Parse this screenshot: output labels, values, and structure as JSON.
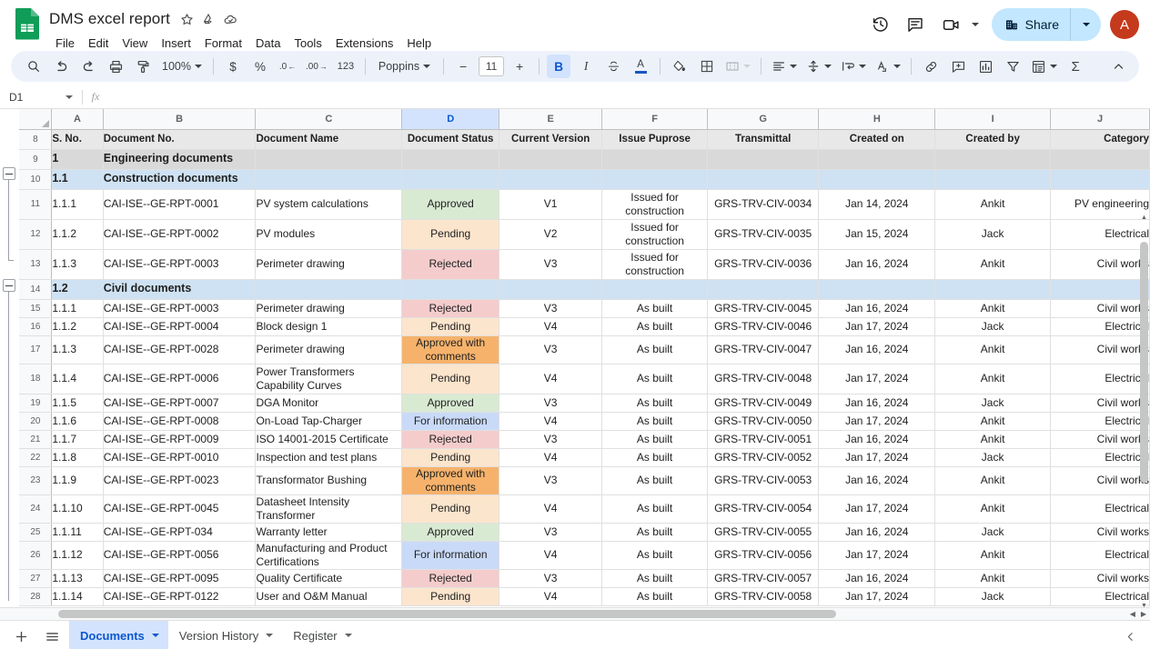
{
  "app": {
    "title": "DMS excel report",
    "logo_icon": "google-sheets-logo",
    "menu": [
      "File",
      "Edit",
      "View",
      "Insert",
      "Format",
      "Data",
      "Tools",
      "Extensions",
      "Help"
    ],
    "title_icons": [
      "star-icon",
      "move-to-drive-icon",
      "cloud-saved-icon"
    ]
  },
  "topright": {
    "history_icon": "version-history-icon",
    "comment_icon": "comment-icon",
    "meet_icon": "video-camera-icon",
    "share_label": "Share",
    "share_icon": "share-building-icon",
    "avatar_initial": "A"
  },
  "toolbar": {
    "zoom": "100%",
    "font": "Poppins",
    "font_size": "11",
    "number_format_123": "123",
    "currency": "$",
    "percent": "%",
    "decimal_decrease": ".0",
    "decimal_increase": ".00",
    "bold": "B",
    "italic": "I",
    "strikethrough": "S",
    "text_color": "A",
    "minus": "−",
    "plus": "+",
    "sum": "Σ",
    "icons": [
      "search-icon",
      "undo-icon",
      "redo-icon",
      "print-icon",
      "paint-format-icon",
      "fill-color-icon",
      "borders-icon",
      "merge-cells-icon",
      "horizontal-align-icon",
      "vertical-align-icon",
      "text-wrap-icon",
      "text-rotation-icon",
      "insert-link-icon",
      "insert-comment-icon",
      "insert-chart-icon",
      "create-filter-icon",
      "functions-icon",
      "collapse-toolbar-icon"
    ]
  },
  "formula_bar": {
    "name_box": "D1",
    "fx_label": "fx",
    "formula_value": ""
  },
  "grid": {
    "columns": [
      "A",
      "B",
      "C",
      "D",
      "E",
      "F",
      "G",
      "H",
      "I",
      "J"
    ],
    "selected_column": "D",
    "header_row_number": "8",
    "headers": [
      "S. No.",
      "Document No.",
      "Document Name",
      "Document Status",
      "Current Version",
      "Issue Puprose",
      "Transmittal",
      "Created on",
      "Created by",
      "Category"
    ],
    "status_colors": {
      "Approved": "#d9ead3",
      "Pending": "#fce5cd",
      "Rejected": "#f4cccc",
      "Approved with comments": "#f6b26b",
      "For information": "#c9daf8"
    },
    "rows": [
      {
        "n": "9",
        "type": "group1",
        "cells": [
          "1",
          "Engineering documents",
          "",
          "",
          "",
          "",
          "",
          "",
          "",
          ""
        ]
      },
      {
        "n": "10",
        "type": "group2",
        "cells": [
          "1.1",
          "Construction documents",
          "",
          "",
          "",
          "",
          "",
          "",
          "",
          ""
        ]
      },
      {
        "n": "11",
        "type": "data",
        "cells": [
          "1.1.1",
          "CAI-ISE--GE-RPT-0001",
          "PV system calculations",
          "Approved",
          "V1",
          "Issued for construction",
          "GRS-TRV-CIV-0034",
          "Jan 14, 2024",
          "Ankit",
          "PV engineering"
        ]
      },
      {
        "n": "12",
        "type": "data",
        "cells": [
          "1.1.2",
          "CAI-ISE--GE-RPT-0002",
          "PV modules",
          "Pending",
          "V2",
          "Issued for construction",
          "GRS-TRV-CIV-0035",
          "Jan 15, 2024",
          "Jack",
          "Electrical"
        ]
      },
      {
        "n": "13",
        "type": "data",
        "cells": [
          "1.1.3",
          "CAI-ISE--GE-RPT-0003",
          "Perimeter drawing",
          "Rejected",
          "V3",
          "Issued for construction",
          "GRS-TRV-CIV-0036",
          "Jan 16, 2024",
          "Ankit",
          "Civil works"
        ]
      },
      {
        "n": "14",
        "type": "group2",
        "cells": [
          "1.2",
          "Civil documents",
          "",
          "",
          "",
          "",
          "",
          "",
          "",
          ""
        ]
      },
      {
        "n": "15",
        "type": "data",
        "cells": [
          "1.1.1",
          "CAI-ISE--GE-RPT-0003",
          "Perimeter drawing",
          "Rejected",
          "V3",
          "As built",
          "GRS-TRV-CIV-0045",
          "Jan 16, 2024",
          "Ankit",
          "Civil works"
        ]
      },
      {
        "n": "16",
        "type": "data",
        "cells": [
          "1.1.2",
          "CAI-ISE--GE-RPT-0004",
          "Block design 1",
          "Pending",
          "V4",
          "As built",
          "GRS-TRV-CIV-0046",
          "Jan 17, 2024",
          "Jack",
          "Electrical"
        ]
      },
      {
        "n": "17",
        "type": "data",
        "cells": [
          "1.1.3",
          "CAI-ISE--GE-RPT-0028",
          "Perimeter drawing",
          "Approved with comments",
          "V3",
          "As built",
          "GRS-TRV-CIV-0047",
          "Jan 16, 2024",
          "Ankit",
          "Civil works"
        ]
      },
      {
        "n": "18",
        "type": "data",
        "cells": [
          "1.1.4",
          "CAI-ISE--GE-RPT-0006",
          "Power Transformers Capability Curves",
          "Pending",
          "V4",
          "As built",
          "GRS-TRV-CIV-0048",
          "Jan 17, 2024",
          "Ankit",
          "Electrical"
        ]
      },
      {
        "n": "19",
        "type": "data",
        "cells": [
          "1.1.5",
          "CAI-ISE--GE-RPT-0007",
          "DGA Monitor",
          "Approved",
          "V3",
          "As built",
          "GRS-TRV-CIV-0049",
          "Jan 16, 2024",
          "Jack",
          "Civil works"
        ]
      },
      {
        "n": "20",
        "type": "data",
        "cells": [
          "1.1.6",
          "CAI-ISE--GE-RPT-0008",
          "On-Load Tap-Charger",
          "For information",
          "V4",
          "As built",
          "GRS-TRV-CIV-0050",
          "Jan 17, 2024",
          "Ankit",
          "Electrical"
        ]
      },
      {
        "n": "21",
        "type": "data",
        "cells": [
          "1.1.7",
          "CAI-ISE--GE-RPT-0009",
          "ISO 14001-2015 Certificate",
          "Rejected",
          "V3",
          "As built",
          "GRS-TRV-CIV-0051",
          "Jan 16, 2024",
          "Ankit",
          "Civil works"
        ]
      },
      {
        "n": "22",
        "type": "data",
        "cells": [
          "1.1.8",
          "CAI-ISE--GE-RPT-0010",
          "Inspection and test plans",
          "Pending",
          "V4",
          "As built",
          "GRS-TRV-CIV-0052",
          "Jan 17, 2024",
          "Jack",
          "Electrical"
        ]
      },
      {
        "n": "23",
        "type": "data",
        "cells": [
          "1.1.9",
          "CAI-ISE--GE-RPT-0023",
          "Transformator Bushing",
          "Approved with comments",
          "V3",
          "As built",
          "GRS-TRV-CIV-0053",
          "Jan 16, 2024",
          "Ankit",
          "Civil works"
        ]
      },
      {
        "n": "24",
        "type": "data",
        "cells": [
          "1.1.10",
          "CAI-ISE--GE-RPT-0045",
          "Datasheet Intensity Transformer",
          "Pending",
          "V4",
          "As built",
          "GRS-TRV-CIV-0054",
          "Jan 17, 2024",
          "Ankit",
          "Electrical"
        ]
      },
      {
        "n": "25",
        "type": "data",
        "cells": [
          "1.1.11",
          "CAI-ISE--GE-RPT-034",
          "Warranty letter",
          "Approved",
          "V3",
          "As built",
          "GRS-TRV-CIV-0055",
          "Jan 16, 2024",
          "Jack",
          "Civil works"
        ]
      },
      {
        "n": "26",
        "type": "data",
        "cells": [
          "1.1.12",
          "CAI-ISE--GE-RPT-0056",
          "Manufacturing and Product Certifications",
          "For information",
          "V4",
          "As built",
          "GRS-TRV-CIV-0056",
          "Jan 17, 2024",
          "Ankit",
          "Electrical"
        ]
      },
      {
        "n": "27",
        "type": "data",
        "cells": [
          "1.1.13",
          "CAI-ISE--GE-RPT-0095",
          "Quality Certificate",
          "Rejected",
          "V3",
          "As built",
          "GRS-TRV-CIV-0057",
          "Jan 16, 2024",
          "Ankit",
          "Civil works"
        ]
      },
      {
        "n": "28",
        "type": "data",
        "cells": [
          "1.1.14",
          "CAI-ISE--GE-RPT-0122",
          "User and O&M Manual",
          "Pending",
          "V4",
          "As built",
          "GRS-TRV-CIV-0058",
          "Jan 17, 2024",
          "Jack",
          "Electrical"
        ]
      }
    ]
  },
  "sheet_tabs": {
    "add_icon": "add-sheet-icon",
    "list_icon": "all-sheets-icon",
    "tabs": [
      {
        "label": "Documents",
        "active": true
      },
      {
        "label": "Version History",
        "active": false,
        "underlined": true
      },
      {
        "label": "Register",
        "active": false,
        "underlined": false
      }
    ],
    "explore_icon": "chevron-left-icon"
  }
}
